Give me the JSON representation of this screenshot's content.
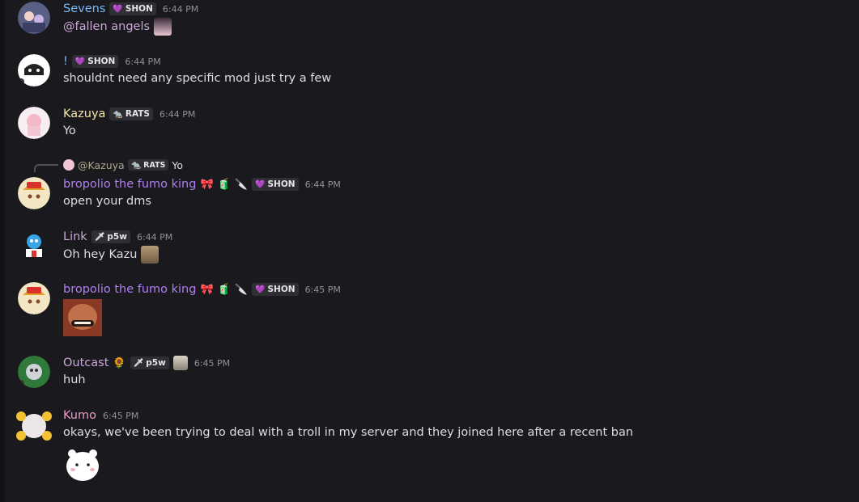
{
  "messages": [
    {
      "username": "Sevens",
      "tag": "SHON",
      "tag_icon": "heart-icon",
      "time": "6:44 PM",
      "content_mention": "@fallen angels",
      "name_color": "#7ab8f5"
    },
    {
      "username": "!",
      "tag": "SHON",
      "tag_icon": "heart-icon",
      "time": "6:44 PM",
      "content": "shouldnt need any specific mod just try a few",
      "name_color": "#7ab8f5"
    },
    {
      "username": "Kazuya",
      "tag": "RATS",
      "tag_icon": "rat-icon",
      "time": "6:44 PM",
      "content": "Yo",
      "name_color": "#f5e6a8"
    },
    {
      "reply_name": "@Kazuya",
      "reply_tag": "RATS",
      "reply_text": "Yo",
      "username": "bropolio the fumo king",
      "tag": "SHON",
      "tag_icon": "heart-icon",
      "time": "6:44 PM",
      "content": "open your dms",
      "name_color": "#b07ef0"
    },
    {
      "username": "Link",
      "tag": "p5w",
      "tag_icon": "sword-icon",
      "time": "6:44 PM",
      "content": "Oh hey Kazu",
      "name_color": "#c9a8d6"
    },
    {
      "username": "bropolio the fumo king",
      "tag": "SHON",
      "tag_icon": "heart-icon",
      "time": "6:45 PM",
      "content": "",
      "name_color": "#b07ef0"
    },
    {
      "username": "Outcast",
      "tag": "p5w",
      "tag_icon": "sword-icon",
      "time": "6:45 PM",
      "content": "huh",
      "name_color": "#c9a8d6"
    },
    {
      "username": "Kumo",
      "time": "6:45 PM",
      "content": "okays, we've been trying to deal with a troll in my server and they joined here after a recent ban",
      "name_color": "#e79cc8"
    }
  ]
}
